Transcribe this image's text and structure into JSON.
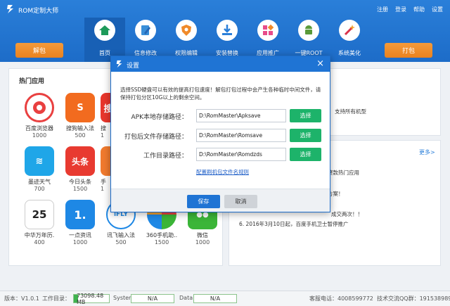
{
  "app": {
    "title": "ROM定制大师"
  },
  "top_links": [
    "注册",
    "登录",
    "帮助",
    "设置"
  ],
  "buttons": {
    "unpack": "解包",
    "pack": "打包"
  },
  "nav": [
    {
      "label": "首页",
      "icon": "home-icon"
    },
    {
      "label": "信息修改",
      "icon": "edit-icon"
    },
    {
      "label": "权限编辑",
      "icon": "shield-icon"
    },
    {
      "label": "安装替换",
      "icon": "download-icon"
    },
    {
      "label": "应用推广",
      "icon": "apps-icon"
    },
    {
      "label": "一键ROOT",
      "icon": "android-icon"
    },
    {
      "label": "系统美化",
      "icon": "magic-wand-icon"
    }
  ],
  "hot_apps": {
    "title": "热门应用",
    "rows": [
      [
        {
          "name": "百度浏览器",
          "count": "1000",
          "color": "#e94040",
          "glyph": "e"
        },
        {
          "name": "搜狗输入法",
          "count": "500",
          "color": "#f26b1f",
          "glyph": "S"
        },
        {
          "name": "搜",
          "count": "1",
          "color": "#e8362c",
          "glyph": "搜"
        }
      ],
      [
        {
          "name": "墨迹天气",
          "count": "700",
          "color": "#1fa6e8",
          "glyph": "≋"
        },
        {
          "name": "今日头条",
          "count": "1500",
          "color": "#e83a30",
          "glyph": "头条"
        },
        {
          "name": "手",
          "count": "1",
          "color": "#f07a2e",
          "glyph": ""
        }
      ],
      [
        {
          "name": "中华万年历.",
          "count": "400",
          "color": "#ffffff",
          "glyph": "25"
        },
        {
          "name": "一点资讯",
          "count": "1000",
          "color": "#1e88e5",
          "glyph": "1."
        },
        {
          "name": "讯飞输入法",
          "count": "500",
          "color": "#ffffff",
          "glyph": "iFLY"
        },
        {
          "name": "360手机助..",
          "count": "1500",
          "color": "#ffffff",
          "glyph": ""
        },
        {
          "name": "微信",
          "count": "1000",
          "color": "#3bb538",
          "glyph": "●●"
        }
      ]
    ]
  },
  "right_panel": {
    "line_top": "支持所有机型",
    "more": "更多>",
    "line1": "赘款热门应用",
    "line2": "方案！",
    "line3": "成交两次！！",
    "line4": "6. 2016年3月10日起，百度手机卫士暂停推广"
  },
  "status": {
    "version": "版本：V1.0.1",
    "workdir_label": "工作目录：",
    "workdir_value": "73098.48 MB",
    "system_label": "System:",
    "system_value": "N/A",
    "data_label": "Data:",
    "data_value": "N/A",
    "phone": "客服电话：4008599772",
    "qq": "技术交流QQ群：191538989"
  },
  "dialog": {
    "title": "设置",
    "note": "选择SSD硬盘可以有效的提高打包速度！解包打包过程中会产生各种临时中间文件，请保持打包分区10G以上的剩余空间。",
    "fields": [
      {
        "label": "APK本地存储路径：",
        "value": "D:\\RomMaster\\Apksave",
        "button": "选择"
      },
      {
        "label": "打包后文件存储路径：",
        "value": "D:\\RomMaster\\Romsave",
        "button": "选择"
      },
      {
        "label": "工作目录路径：",
        "value": "D:\\RomMaster\\Romdzds",
        "button": "选择"
      }
    ],
    "link": "配置刷机包文件名规则",
    "save": "保存",
    "cancel": "取消"
  }
}
